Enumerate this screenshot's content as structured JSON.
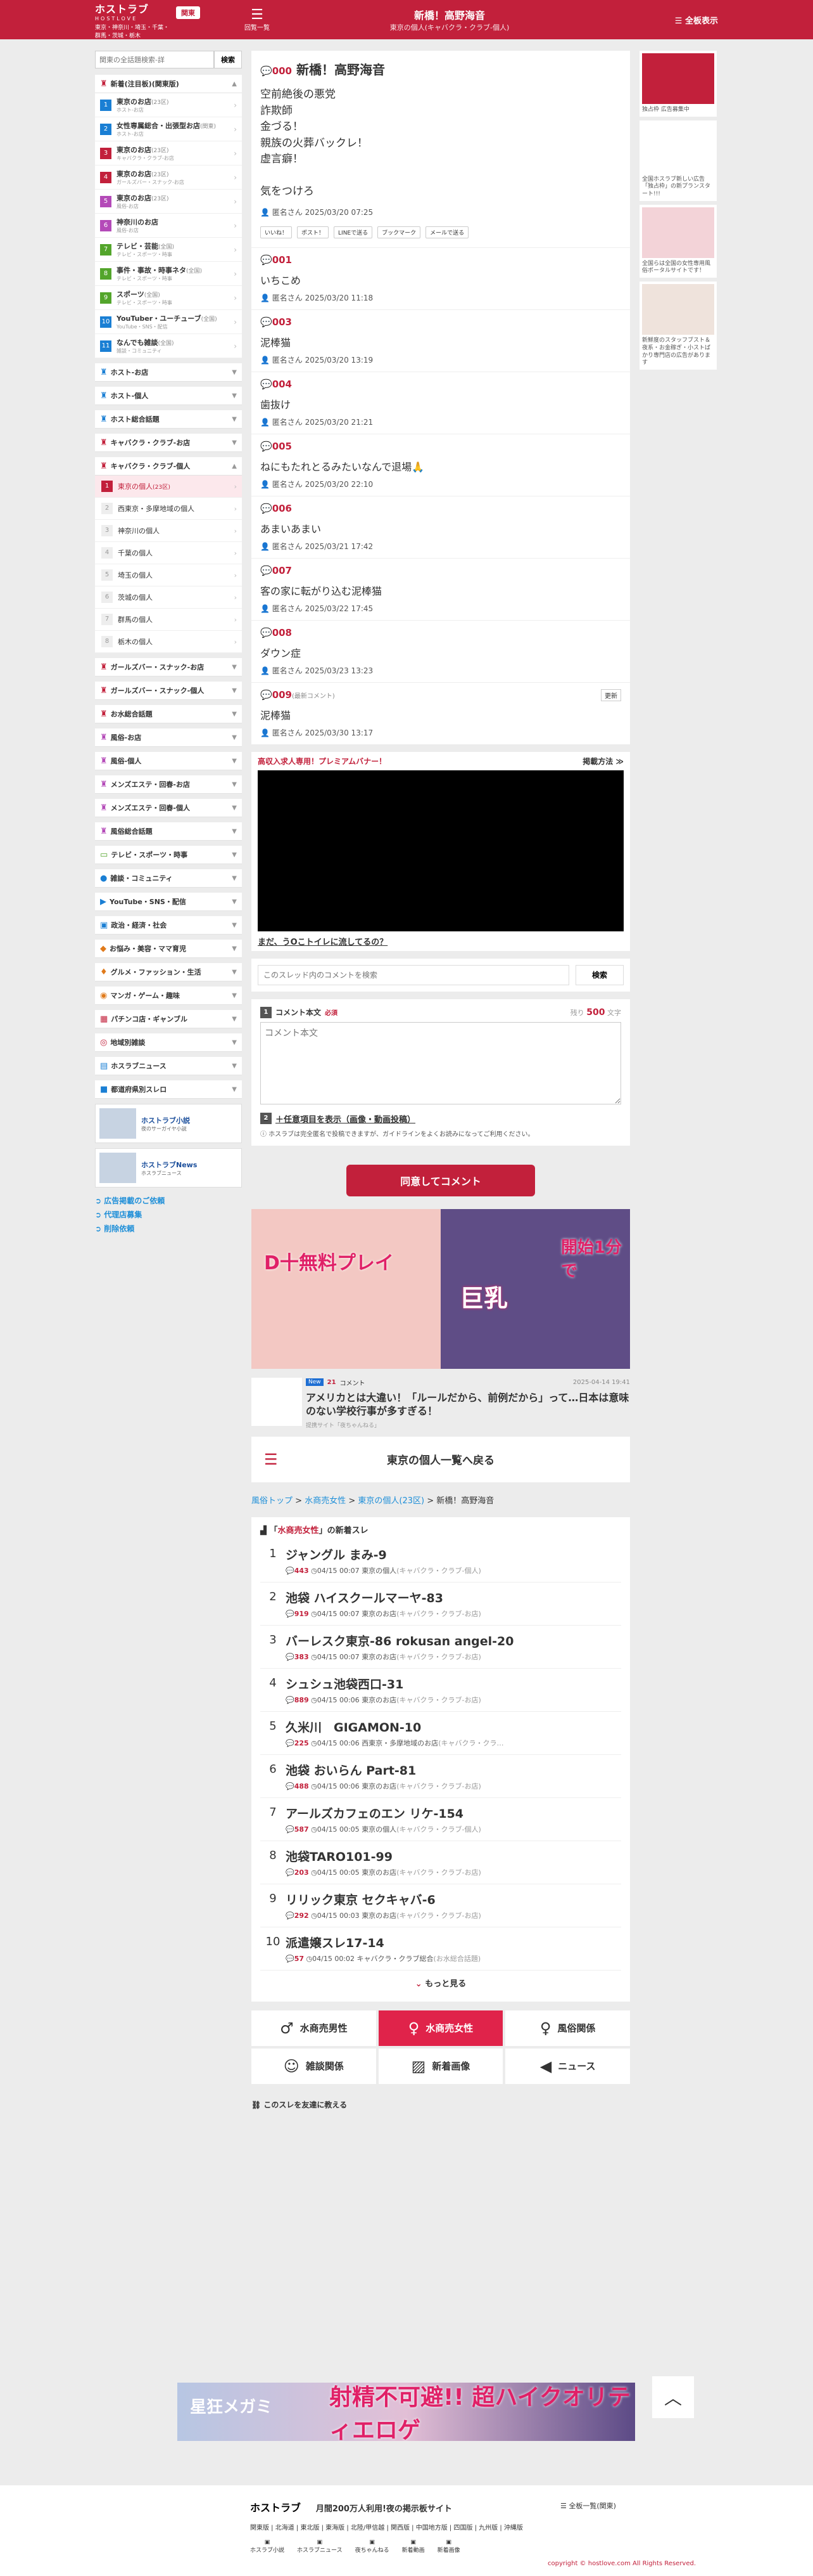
{
  "header": {
    "logo": "ホストラブ",
    "logo_sub": "HOSTLOVE",
    "area": "東京・神奈川・埼玉・千葉・群馬・茨城・栃木",
    "region_btn": "関東",
    "menu_label": "回覧一覧",
    "title": "新橋！高野海音",
    "subtitle": "東京の個人(キャバクラ・クラブ-個人)",
    "all_display": "全板表示"
  },
  "sidebar": {
    "search_placeholder": "関東の全話題検索-詳",
    "search_btn": "検索",
    "group_new": "新着(注目板)(関東版)",
    "items": [
      {
        "n": "1",
        "label": "東京のお店",
        "paren": "(23区)",
        "sub": "ホスト-お店",
        "color": "#1a7fd4"
      },
      {
        "n": "2",
        "label": "女性専属総合・出張型お店",
        "paren": "(関東)",
        "sub": "ホスト-お店",
        "color": "#1a7fd4"
      },
      {
        "n": "3",
        "label": "東京のお店",
        "paren": "(23区)",
        "sub": "キャバクラ・クラブ-お店",
        "color": "#c2203b"
      },
      {
        "n": "4",
        "label": "東京のお店",
        "paren": "(23区)",
        "sub": "ガールズバー・スナック-お店",
        "color": "#c2203b"
      },
      {
        "n": "5",
        "label": "東京のお店",
        "paren": "(23区)",
        "sub": "風俗-お店",
        "color": "#b44ab8"
      },
      {
        "n": "6",
        "label": "神奈川のお店",
        "paren": "",
        "sub": "風俗-お店",
        "color": "#b44ab8"
      },
      {
        "n": "7",
        "label": "テレビ・芸能",
        "paren": "(全国)",
        "sub": "テレビ・スポーツ・時事",
        "color": "#53a52b"
      },
      {
        "n": "8",
        "label": "事件・事故・時事ネタ",
        "paren": "(全国)",
        "sub": "テレビ・スポーツ・時事",
        "color": "#53a52b"
      },
      {
        "n": "9",
        "label": "スポーツ",
        "paren": "(全国)",
        "sub": "テレビ・スポーツ・時事",
        "color": "#53a52b"
      },
      {
        "n": "10",
        "label": "YouTuber・ユーチューブ",
        "paren": "(全国)",
        "sub": "YouTube・SNS・配信",
        "color": "#1a7fd4"
      },
      {
        "n": "11",
        "label": "なんでも雑談",
        "paren": "(全国)",
        "sub": "雑談・コミュニティ",
        "color": "#1a7fd4"
      }
    ],
    "cats_a": [
      {
        "label": "ホスト-お店",
        "icon": "♜",
        "color": "#1a7fd4"
      },
      {
        "label": "ホスト-個人",
        "icon": "♜",
        "color": "#1a7fd4"
      },
      {
        "label": "ホスト総合話題",
        "icon": "♜",
        "color": "#1a7fd4"
      },
      {
        "label": "キャバクラ・クラブ-お店",
        "icon": "♜",
        "color": "#c2203b"
      }
    ],
    "open_cat": "キャバクラ・クラブ-個人",
    "subs": [
      {
        "n": "1",
        "label": "東京の個人",
        "paren": "(23区)"
      },
      {
        "n": "2",
        "label": "西東京・多摩地域の個人",
        "paren": ""
      },
      {
        "n": "3",
        "label": "神奈川の個人",
        "paren": ""
      },
      {
        "n": "4",
        "label": "千葉の個人",
        "paren": ""
      },
      {
        "n": "5",
        "label": "埼玉の個人",
        "paren": ""
      },
      {
        "n": "6",
        "label": "茨城の個人",
        "paren": ""
      },
      {
        "n": "7",
        "label": "群馬の個人",
        "paren": ""
      },
      {
        "n": "8",
        "label": "栃木の個人",
        "paren": ""
      }
    ],
    "cats_b": [
      {
        "label": "ガールズバー・スナック-お店",
        "icon": "♜",
        "color": "#c2203b"
      },
      {
        "label": "ガールズバー・スナック-個人",
        "icon": "♜",
        "color": "#c2203b"
      },
      {
        "label": "お水総合話題",
        "icon": "♜",
        "color": "#c2203b"
      },
      {
        "label": "風俗-お店",
        "icon": "♜",
        "color": "#b44ab8"
      },
      {
        "label": "風俗-個人",
        "icon": "♜",
        "color": "#b44ab8"
      },
      {
        "label": "メンズエステ・回春-お店",
        "icon": "♜",
        "color": "#b44ab8"
      },
      {
        "label": "メンズエステ・回春-個人",
        "icon": "♜",
        "color": "#b44ab8"
      },
      {
        "label": "風俗総合話題",
        "icon": "♜",
        "color": "#b44ab8"
      },
      {
        "label": "テレビ・スポーツ・時事",
        "icon": "▭",
        "color": "#53a52b"
      },
      {
        "label": "雑談・コミュニティ",
        "icon": "●",
        "color": "#1a7fd4"
      },
      {
        "label": "YouTube・SNS・配信",
        "icon": "▶",
        "color": "#1a7fd4"
      },
      {
        "label": "政治・経済・社会",
        "icon": "▣",
        "color": "#1a7fd4"
      },
      {
        "label": "お悩み・美容・ママ育児",
        "icon": "◆",
        "color": "#e07a1a"
      },
      {
        "label": "グルメ・ファッション・生活",
        "icon": "♦",
        "color": "#e07a1a"
      },
      {
        "label": "マンガ・ゲーム・趣味",
        "icon": "◉",
        "color": "#e07a1a"
      },
      {
        "label": "パチンコ店・ギャンブル",
        "icon": "▦",
        "color": "#c2203b"
      },
      {
        "label": "地域別雑談",
        "icon": "◎",
        "color": "#c2203b"
      },
      {
        "label": "ホスラブニュース",
        "icon": "▤",
        "color": "#1a7fd4"
      },
      {
        "label": "都道府県別スレロ",
        "icon": "■",
        "color": "#1a7fd4"
      }
    ],
    "banners": [
      {
        "title": "ホストラブ小説",
        "sub": "夜のサーガイヤ小説"
      },
      {
        "title": "ホストラブNews",
        "sub": "ホスラブニュース"
      }
    ],
    "links": [
      "広告掲載のご依頼",
      "代理店募集",
      "削除依頼"
    ]
  },
  "thread": {
    "post0": {
      "num": "000",
      "title": "新橋！高野海音",
      "body": "空前絶後の悪党\n詐欺師\n金づる！\n親族の火葬バックレ！\n虚言癖！\n\n気をつけろ",
      "meta": "匿名さん 2025/03/20 07:25"
    },
    "share": [
      "いいね！",
      "ポスト！",
      "LINEで送る",
      "ブックマーク",
      "メールで送る"
    ],
    "posts": [
      {
        "num": "001",
        "body": "いちこめ",
        "meta": "匿名さん 2025/03/20 11:18",
        "tag": "",
        "upd": ""
      },
      {
        "num": "003",
        "body": "泥棒猫",
        "meta": "匿名さん 2025/03/20 13:19",
        "tag": "",
        "upd": ""
      },
      {
        "num": "004",
        "body": "歯抜け",
        "meta": "匿名さん 2025/03/20 21:21",
        "tag": "",
        "upd": ""
      },
      {
        "num": "005",
        "body": "ねにもたれとるみたいなんで退場🙏",
        "meta": "匿名さん 2025/03/20 22:10",
        "tag": "",
        "upd": ""
      },
      {
        "num": "006",
        "body": "あまいあまい",
        "meta": "匿名さん 2025/03/21 17:42",
        "tag": "",
        "upd": ""
      },
      {
        "num": "007",
        "body": "客の家に転がり込む泥棒猫",
        "meta": "匿名さん 2025/03/22 17:45",
        "tag": "",
        "upd": ""
      },
      {
        "num": "008",
        "body": "ダウン症",
        "meta": "匿名さん 2025/03/23 13:23",
        "tag": "",
        "upd": ""
      },
      {
        "num": "009",
        "body": "泥棒猫",
        "meta": "匿名さん 2025/03/30 13:17",
        "tag": "(最新コメント)",
        "upd": "更新"
      }
    ]
  },
  "premium": {
    "title": "高収入求人専用！プレミアムバナー！",
    "link": "掲載方法 ≫",
    "caption": "まだ、うOこトイレに流してるの？"
  },
  "comment_search": {
    "placeholder": "このスレッド内のコメントを検索",
    "btn": "検索"
  },
  "comment_form": {
    "step1": "1",
    "label": "コメント本文",
    "required": "必須",
    "count_pre": "残り",
    "count": "500",
    "count_post": "文字",
    "placeholder": "コメント本文",
    "step2": "2",
    "options": "＋任意項目を表示（画像・動画投稿）",
    "note": "ホスラブは完全匿名で投稿できますが、ガイドラインをよくお読みになってご利用ください。",
    "submit": "同意してコメント"
  },
  "banner_mid": {
    "left": "D十無料プレイ",
    "right": "巨乳",
    "mid": "開始1分で"
  },
  "news": {
    "badge": "New",
    "count": "21",
    "count_label": "コメント",
    "date": "2025-04-14 19:41",
    "title": "アメリカとは大違い！「ルールだから、前例だから」って…日本は意味のない学校行事が多すぎる！",
    "source": "提携サイト「夜ちゃんねる」"
  },
  "back": "東京の個人一覧へ戻る",
  "breadcrumb": [
    "風俗トップ",
    "水商売女性",
    "東京の個人",
    "(23区)",
    "新橋！高野海音"
  ],
  "newthreads": {
    "title_pre": "「",
    "title_red": "水商売女性",
    "title_post": "」の新着スレ",
    "rows": [
      {
        "rank": "1",
        "title": "ジャングル まみ-9",
        "count": "443",
        "date": "04/15 00:07",
        "cat": "東京の個人",
        "cat2": "(キャバクラ・クラブ-個人)"
      },
      {
        "rank": "2",
        "title": "池袋 ハイスクールマーヤ-83",
        "count": "919",
        "date": "04/15 00:07",
        "cat": "東京のお店",
        "cat2": "(キャバクラ・クラブ-お店)"
      },
      {
        "rank": "3",
        "title": "バーレスク東京-86 rokusan angel-20",
        "count": "383",
        "date": "04/15 00:07",
        "cat": "東京のお店",
        "cat2": "(キャバクラ・クラブ-お店)"
      },
      {
        "rank": "4",
        "title": "シュシュ池袋西口-31",
        "count": "889",
        "date": "04/15 00:06",
        "cat": "東京のお店",
        "cat2": "(キャバクラ・クラブ-お店)"
      },
      {
        "rank": "5",
        "title": "久米川　GIGAMON-10",
        "count": "225",
        "date": "04/15 00:06",
        "cat": "西東京・多摩地域のお店",
        "cat2": "(キャバクラ・クラ…"
      },
      {
        "rank": "6",
        "title": "池袋 おいらん Part-81",
        "count": "488",
        "date": "04/15 00:06",
        "cat": "東京のお店",
        "cat2": "(キャバクラ・クラブ-お店)"
      },
      {
        "rank": "7",
        "title": "アールズカフェのエン リケ-154",
        "count": "587",
        "date": "04/15 00:05",
        "cat": "東京の個人",
        "cat2": "(キャバクラ・クラブ-個人)"
      },
      {
        "rank": "8",
        "title": "池袋TARO101-99",
        "count": "203",
        "date": "04/15 00:05",
        "cat": "東京のお店",
        "cat2": "(キャバクラ・クラブ-お店)"
      },
      {
        "rank": "9",
        "title": "リリック東京 セクキャバ-6",
        "count": "292",
        "date": "04/15 00:03",
        "cat": "東京のお店",
        "cat2": "(キャバクラ・クラブ-お店)"
      },
      {
        "rank": "10",
        "title": "派遣嬢スレ17-14",
        "count": "57",
        "date": "04/15 00:02",
        "cat": "キャバクラ・クラブ総合",
        "cat2": "(お水総合話題)"
      }
    ],
    "more": "もっと見る"
  },
  "categories": [
    {
      "label": "水商売男性",
      "icon": "♂",
      "active": false
    },
    {
      "label": "水商売女性",
      "icon": "♀",
      "active": true
    },
    {
      "label": "風俗関係",
      "icon": "♀",
      "active": false
    },
    {
      "label": "雑談関係",
      "icon": "☺",
      "active": false
    },
    {
      "label": "新着画像",
      "icon": "▨",
      "active": false
    },
    {
      "label": "ニュース",
      "icon": "◀",
      "active": false
    }
  ],
  "sharebar": "このスレを友達に教える",
  "bottom_banner": {
    "logo": "星狂メガミ",
    "text": "射精不可避!! 超ハイクオリティエロゲ"
  },
  "footer": {
    "logo": "ホストラブ",
    "tagline": "月間200万人利用!夜の掲示板サイト",
    "all": "全板一覧(関東)",
    "regions": "関東版 | 北海道 | 東北版 | 東海版 | 北陸/甲信越 | 関西版 | 中国地方版 | 四国版 | 九州版 | 沖縄版",
    "icons": [
      "ホスラブ小説",
      "ホスラブニュース",
      "夜ちゃんねる",
      "新着動画",
      "新着画像"
    ],
    "copyright": "copyright © hostlove.com All Rights Reserved."
  },
  "right_ads": [
    {
      "text": "独占枠 広告募集中",
      "color": "#c2203b"
    },
    {
      "text": "全国ホスラブ新しい広告「独占枠」の新プランスタート!!!",
      "color": "#fff"
    },
    {
      "text": "全国らは全国の女性専用風俗ポータルサイトです！",
      "color": "#f3d3d8"
    },
    {
      "text": "新鮮度のスタッフブスト＆夜系・お金稼ぎ・小ストばかり専門店の広告があります",
      "color": "#efe3dc"
    }
  ],
  "colors": {
    "brand": "#c2203b",
    "link": "#1f8fd8"
  }
}
